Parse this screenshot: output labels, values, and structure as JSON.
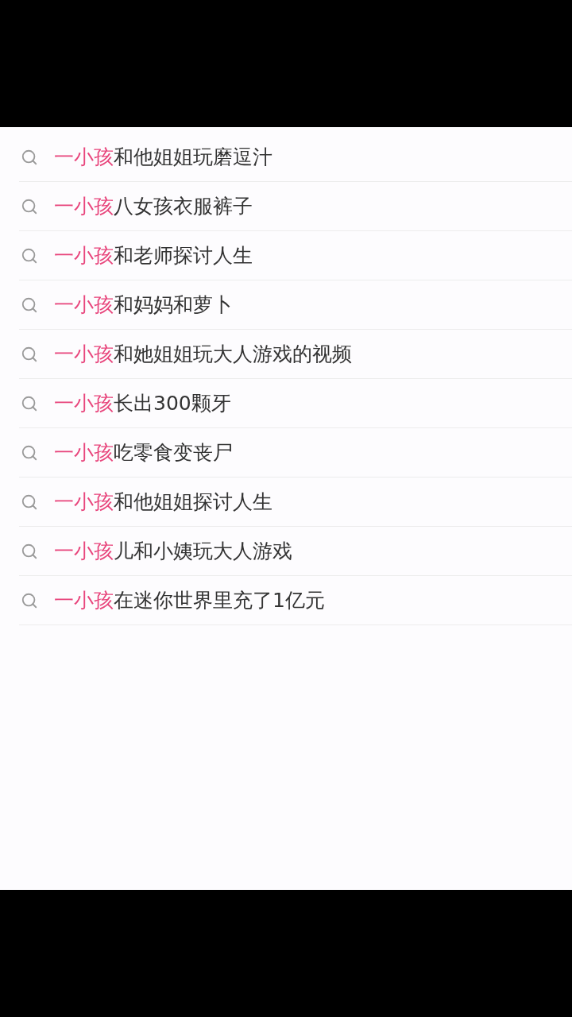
{
  "suggestions": [
    {
      "match": "一小孩",
      "rest": "和他姐姐玩磨逗汁"
    },
    {
      "match": "一小孩",
      "rest": "八女孩衣服裤子"
    },
    {
      "match": "一小孩",
      "rest": "和老师探讨人生"
    },
    {
      "match": "一小孩",
      "rest": "和妈妈和萝卜"
    },
    {
      "match": "一小孩",
      "rest": "和她姐姐玩大人游戏的视频"
    },
    {
      "match": "一小孩",
      "rest": "长出300颗牙"
    },
    {
      "match": "一小孩",
      "rest": "吃零食变丧尸"
    },
    {
      "match": "一小孩",
      "rest": "和他姐姐探讨人生"
    },
    {
      "match": "一小孩",
      "rest": "儿和小姨玩大人游戏"
    },
    {
      "match": "一小孩",
      "rest": "在迷你世界里充了1亿元"
    }
  ]
}
